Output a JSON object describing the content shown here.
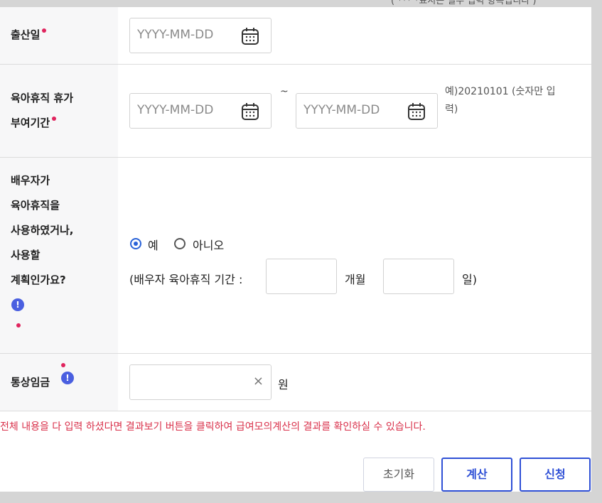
{
  "top_cut_text": "( *** *표시는 필수 입력 항목입니다 )",
  "rows": {
    "birth": {
      "label": "출산일",
      "placeholder": "YYYY-MM-DD"
    },
    "leave": {
      "label_line1": "육아휴직 휴가",
      "label_line2": "부여기간",
      "start_placeholder": "YYYY-MM-DD",
      "end_placeholder": "YYYY-MM-DD",
      "tilde": "~",
      "hint_line1": "예)20210101 (숫자만 입",
      "hint_line2": "력)"
    },
    "spouse": {
      "label_lines": [
        "배우자가",
        "육아휴직을",
        "사용하였거나,",
        "사용할",
        "계획인가요?"
      ],
      "options": [
        "예",
        "아니오"
      ],
      "selected": "예",
      "period_prefix": "(배우자 육아휴직 기간 :",
      "months_unit": "개월",
      "days_unit": "일)"
    },
    "wage": {
      "label": "통상임금",
      "clear_icon": "×",
      "unit": "원"
    }
  },
  "info_icon": "!",
  "notice": "전체 내용을 다 입력 하셨다면 결과보기 버튼을 클릭하여 급여모의계산의 결과를 확인하실 수 있습니다.",
  "buttons": {
    "reset": "초기화",
    "calc": "계산",
    "apply": "신청"
  },
  "colors": {
    "required": "#e0245e",
    "info": "#4a5fe0",
    "primary": "#2f50d6",
    "notice": "#d9304a"
  }
}
